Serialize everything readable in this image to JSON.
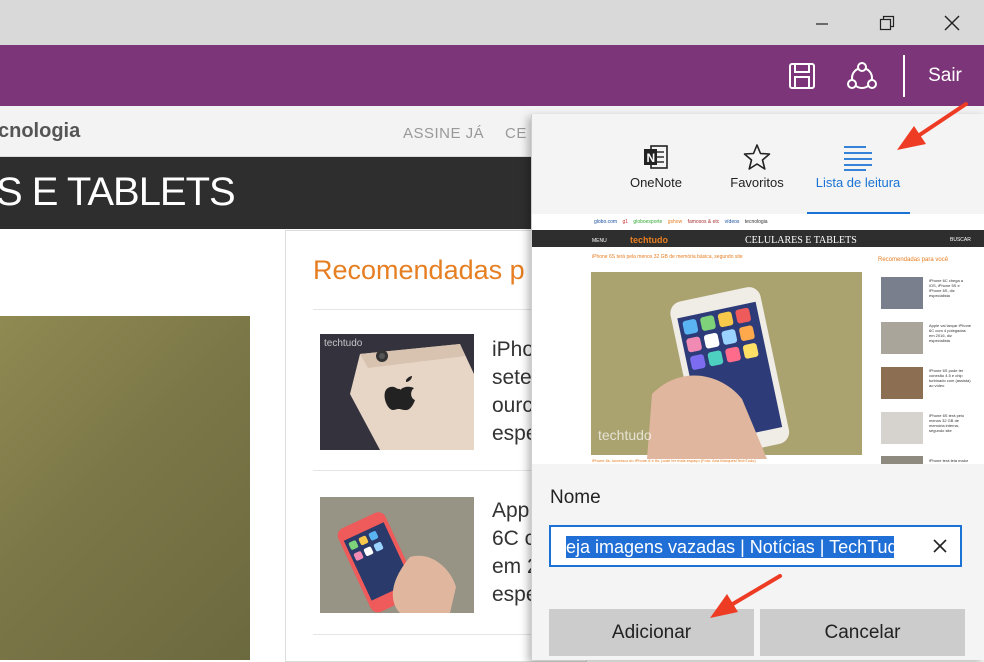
{
  "window": {
    "minimize_icon": "minimize-icon",
    "restore_icon": "restore-icon",
    "close_icon": "close-icon"
  },
  "toolbar": {
    "color": "#7b3578",
    "save_icon": "save-icon",
    "share_icon": "share-icon",
    "exit_label": "Sair"
  },
  "site": {
    "section": "cnologia",
    "links": [
      "ASSINE JÁ",
      "CE"
    ],
    "category_title": "S E TABLETS"
  },
  "recommended": {
    "heading": "Recomendadas p",
    "items": [
      {
        "lines": [
          "iPho",
          "sete",
          "ourc",
          "espe"
        ]
      },
      {
        "lines": [
          "App",
          "6C c",
          "em 2",
          "espe"
        ]
      }
    ]
  },
  "panel": {
    "tabs": [
      {
        "label": "OneNote",
        "icon": "onenote-icon"
      },
      {
        "label": "Favoritos",
        "icon": "star-icon"
      },
      {
        "label": "Lista de leitura",
        "icon": "reading-list-icon",
        "selected": true
      }
    ],
    "accent": "#1a73d4",
    "name_label": "Nome",
    "name_value": "eja imagens vazadas | Notícias | TechTudo",
    "add_label": "Adicionar",
    "cancel_label": "Cancelar"
  },
  "preview": {
    "top_links": [
      "globo.com",
      "g1",
      "globoesporte",
      "gshow",
      "famosos & etc",
      "vídeos",
      "tecnologia"
    ],
    "menu_label": "MENU",
    "brand": "techtudo",
    "category": "CELULARES E TABLETS",
    "search_label": "BUSCAR",
    "headline": "iPhone 6S terá pela menos 32 GB de memória básica, segundo site",
    "watermark": "techtudo",
    "caption": "iPhone 6s, sucessor do iPhone 6 e 6s, pode ter mais espaço (Foto: Ana Marques/TechTudo)",
    "rec_heading": "Recomendadas para você",
    "rec_items": [
      [
        "iPhone 6C chega a",
        "iOS, iPhone 5S e",
        "iPhone 6S, diz",
        "especialista"
      ],
      [
        "Apple vai lançar iPhone",
        "6C com 4 polegadas",
        "em 2016, diz",
        "especialista"
      ],
      [
        "iPhone 6S pode ter",
        "conexão 4.5 e chip",
        "turbinado com (assista)",
        "ao vídeo"
      ],
      [
        "iPhone 6S terá pelo",
        "menos 32 GB de",
        "memória interna,",
        "segundo site"
      ],
      [
        "iPhone terá tela maior"
      ]
    ]
  }
}
